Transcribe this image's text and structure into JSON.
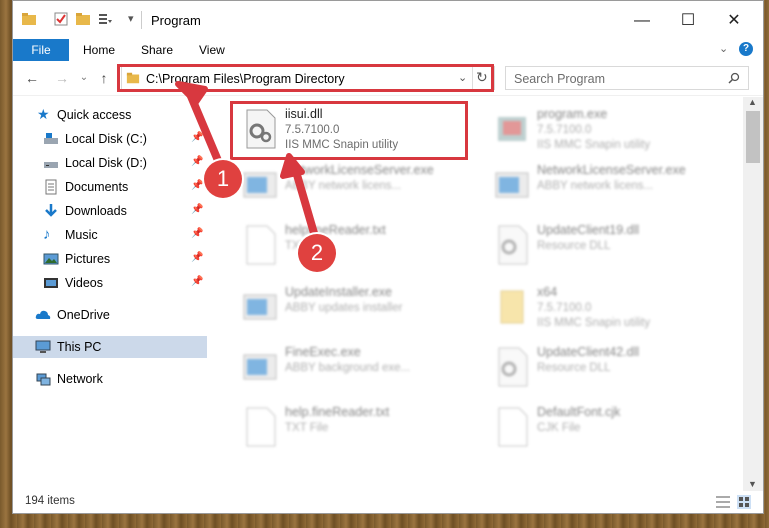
{
  "title": "Program",
  "ribbon": {
    "file": "File",
    "tabs": [
      "Home",
      "Share",
      "View"
    ]
  },
  "address": {
    "path": "C:\\Program Files\\Program Directory"
  },
  "search": {
    "placeholder": "Search Program"
  },
  "nav": {
    "quick_access": "Quick access",
    "items": [
      {
        "label": "Local Disk (C:)",
        "icon": "drive-icon"
      },
      {
        "label": "Local Disk (D:)",
        "icon": "drive-icon"
      },
      {
        "label": "Documents",
        "icon": "documents-icon"
      },
      {
        "label": "Downloads",
        "icon": "downloads-icon"
      },
      {
        "label": "Music",
        "icon": "music-icon"
      },
      {
        "label": "Pictures",
        "icon": "pictures-icon"
      },
      {
        "label": "Videos",
        "icon": "videos-icon"
      }
    ],
    "onedrive": "OneDrive",
    "thispc": "This PC",
    "network": "Network"
  },
  "highlight_file": {
    "name": "iisui.dll",
    "version": "7.5.7100.0",
    "desc": "IIS MMC Snapin utility"
  },
  "blurred_files": [
    {
      "name": "program.exe",
      "sub": "7.5.7100.0",
      "sub2": "IIS MMC Snapin utility"
    },
    {
      "name": "NetworkLicenseServer.exe",
      "sub": "ABBY network licens..."
    },
    {
      "name": "NetworkLicenseServer.exe",
      "sub": "ABBY network licens..."
    },
    {
      "name": "helpfineReader.txt",
      "sub": "TXT File"
    },
    {
      "name": "UpdateClient19.dll",
      "sub": "Resource DLL"
    },
    {
      "name": "UpdateInstaller.exe",
      "sub": "ABBY updates installer"
    },
    {
      "name": "x64",
      "sub": "7.5.7100.0",
      "sub2": "IIS MMC Snapin utility"
    },
    {
      "name": "FineExec.exe",
      "sub": "ABBY background exe..."
    },
    {
      "name": "UpdateClient42.dll",
      "sub": "Resource DLL"
    },
    {
      "name": "help.fineReader.txt",
      "sub": "TXT File"
    },
    {
      "name": "DefaultFont.cjk",
      "sub": "CJK File"
    }
  ],
  "status": {
    "count": "194 items"
  },
  "badges": [
    "1",
    "2"
  ],
  "colors": {
    "accent": "#1979ca",
    "highlight": "#d8383f",
    "selected": "#ccd9ea"
  }
}
